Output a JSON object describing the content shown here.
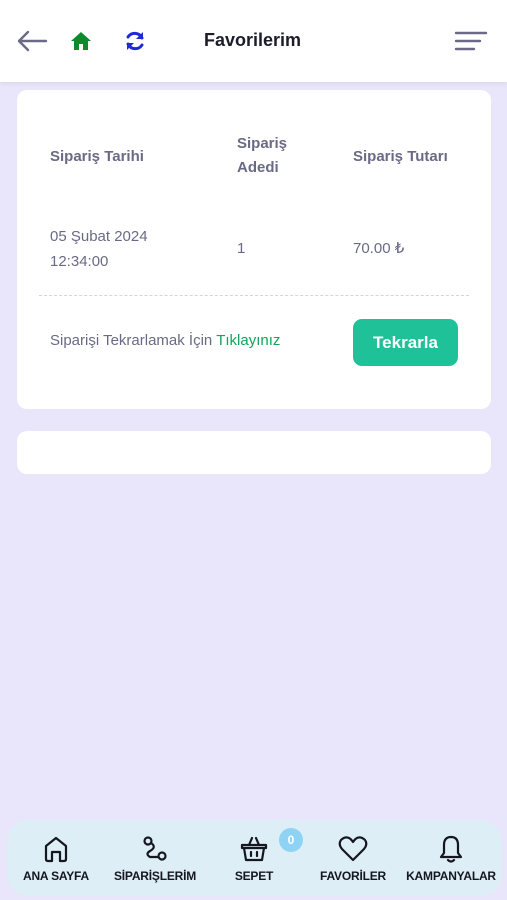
{
  "header": {
    "title": "Favorilerim",
    "back_icon": "arrow-left-icon",
    "home_icon": "home-icon",
    "refresh_icon": "refresh-icon",
    "menu_icon": "menu-icon"
  },
  "order_card": {
    "columns": {
      "date": "Sipariş Tarihi",
      "count": "Sipariş Adedi",
      "total": "Sipariş Tutarı"
    },
    "row": {
      "date": "05 Şubat 2024",
      "time": "12:34:00",
      "count": "1",
      "total": "70.00 ₺"
    },
    "repeat_text": "Siparişi Tekrarlamak İçin",
    "repeat_link": "Tıklayınız",
    "repeat_button": "Tekrarla"
  },
  "bottom_nav": {
    "items": [
      {
        "label": "ANA SAYFA",
        "icon": "home-outline-icon"
      },
      {
        "label": "SİPARİŞLERİM",
        "icon": "route-icon"
      },
      {
        "label": "SEPET",
        "icon": "basket-icon"
      },
      {
        "label": "FAVORİLER",
        "icon": "heart-icon"
      },
      {
        "label": "KAMPANYALAR",
        "icon": "bell-icon"
      }
    ],
    "cart_badge": "0"
  },
  "colors": {
    "background": "#e9e6fb",
    "accent_green": "#13a35a",
    "button_teal": "#1ec198",
    "refresh_blue": "#1f2ad6",
    "nav_bg": "#ddeef6",
    "badge": "#8fd3f4"
  }
}
